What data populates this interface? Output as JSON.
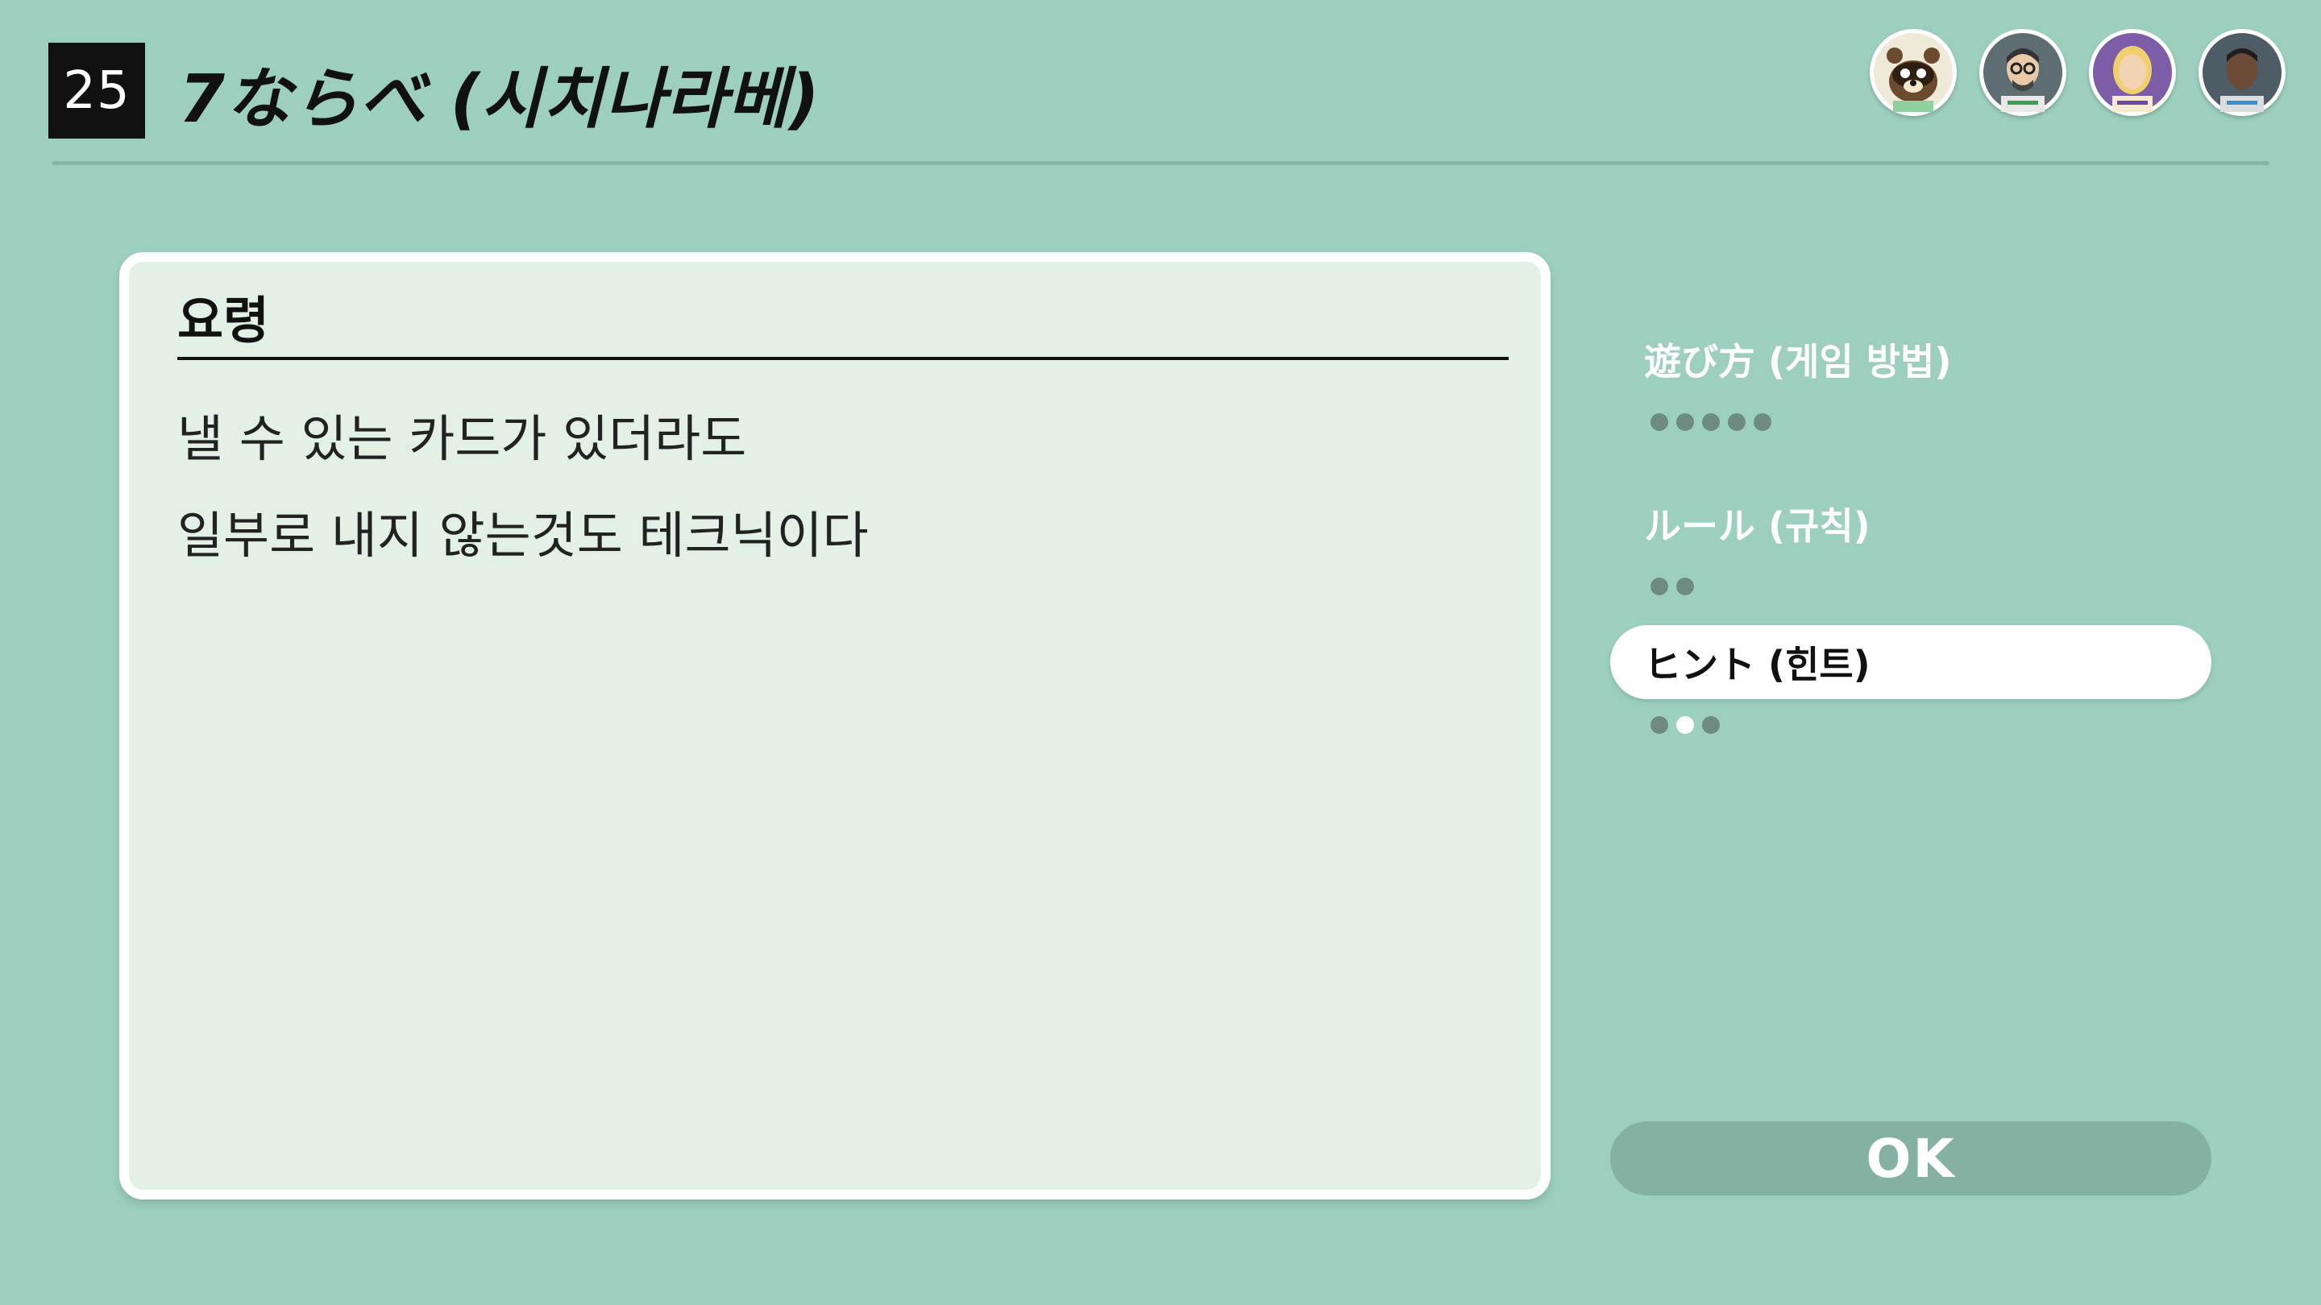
{
  "header": {
    "game_number": "25",
    "game_title": "7ならべ (시치나라베)"
  },
  "players": [
    {
      "name": "tom-nook-avatar",
      "colors": {
        "bg": "#e8e4d6",
        "accent": "#6b4a2e"
      }
    },
    {
      "name": "player-avatar-glasses",
      "colors": {
        "bg": "#5a6a6e",
        "accent": "#3aa04a"
      }
    },
    {
      "name": "player-avatar-blonde",
      "colors": {
        "bg": "#7b5ea7",
        "accent": "#f0cf6c"
      }
    },
    {
      "name": "player-avatar-dark",
      "colors": {
        "bg": "#4e5c66",
        "accent": "#3a8fd0"
      }
    }
  ],
  "panel": {
    "heading": "요령",
    "lines": [
      "낼 수 있는 카드가 있더라도",
      "일부로 내지 않는것도 테크닉이다"
    ]
  },
  "menu": {
    "items": [
      {
        "label": "遊び方 (게임 방법)",
        "dots": 5,
        "active_dot": -1,
        "selected": false
      },
      {
        "label": "ルール (규칙)",
        "dots": 2,
        "active_dot": -1,
        "selected": false
      },
      {
        "label": "ヒント (힌트)",
        "dots": 3,
        "active_dot": 1,
        "selected": true
      }
    ]
  },
  "ok_button": {
    "label": "OK"
  },
  "colors": {
    "background": "#9ccfbd",
    "panel": "#e3f0e6",
    "button_disabled": "#84b1a1"
  }
}
